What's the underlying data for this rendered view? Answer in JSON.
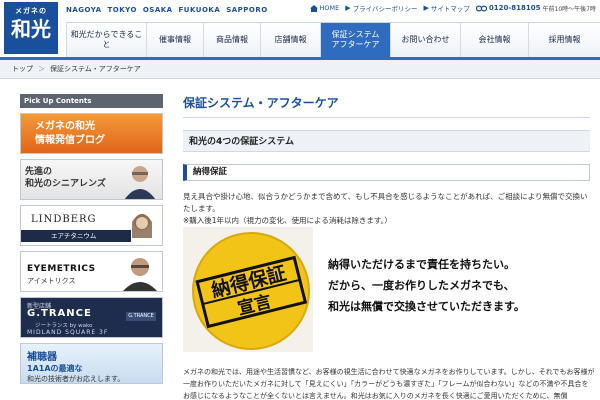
{
  "header": {
    "logo_small": "メガネの",
    "logo_large": "和光",
    "cities": "NAGOYA  TOKYO  OSAKA  FUKUOKA  SAPPORO",
    "top_links": {
      "home": "HOME",
      "privacy": "プライバシーポリシー",
      "sitemap": "サイトマップ"
    },
    "phone": "0120-818105",
    "hours": "午前10時〜午後7時"
  },
  "nav": [
    {
      "label": "和光だからできること"
    },
    {
      "label": "催事情報"
    },
    {
      "label": "商品情報"
    },
    {
      "label": "店舗情報"
    },
    {
      "label": "保証システム\nアフターケア"
    },
    {
      "label": "お問い合わせ"
    },
    {
      "label": "会社情報"
    },
    {
      "label": "採用情報"
    }
  ],
  "breadcrumb": {
    "home": "トップ",
    "separator": "＞",
    "current": "保証システム・アフターケア"
  },
  "sidebar": {
    "heading": "Pick Up Contents",
    "banners": [
      {
        "line1": "メガネの和光",
        "line2": "情報発信ブログ"
      },
      {
        "line1": "先進の",
        "line2": "和光のシニアレンズ"
      },
      {
        "title": "LINDBERG",
        "sub": "エアチタニウム"
      },
      {
        "title": "EYEMETRICS",
        "sub": "アイメトリクス"
      },
      {
        "small": "新型店舗",
        "title": "G.TRANCE",
        "sub": "ジートランス by wako",
        "tag": "G.TRANCE",
        "bottom": "MIDLAND SQUARE 3F"
      },
      {
        "line1": "補聴器",
        "line2": "1A1Aの最適な",
        "line3": "和光の技術者がお応えします。"
      }
    ]
  },
  "main": {
    "title": "保証システム・アフターケア",
    "subtitle": "和光の4つの保証システム",
    "section": "納得保証",
    "para1_line1": "見え具合や掛け心地、似合うかどうかまで含めて、もし不具合を感じるようなことがあれば、ご相談により無償で交換いたします。",
    "para1_line2": "※購入後1年以内（視力の変化、使用による消耗は除きます。）",
    "badge_line1": "納得保証",
    "badge_line2": "宣言",
    "message": [
      "納得いただけるまで責任を持ちたい。",
      "だから、一度お作りしたメガネでも、",
      "和光は無償で交換させていただきます。"
    ],
    "para2": "メガネの和光では、用途や生活習慣など、お客様の視生活に合わせて快適なメガネをお作りしています。しかし、それでもお客様が一度お作りいただいたメガネに対して「見えにくい」「カラーがどうも濃すぎた」「フレームが似合わない」などの不満や不具合をお感じになるようなことが全くないとは言えません。和光はお気に入りのメガネを長く快適にご愛用いただくために、無償"
  },
  "colors": {
    "brand": "#1a4f9c",
    "nav_active": "#2f6cbf",
    "blog_orange": "#e0651a",
    "badge_yellow": "#f2c417"
  }
}
